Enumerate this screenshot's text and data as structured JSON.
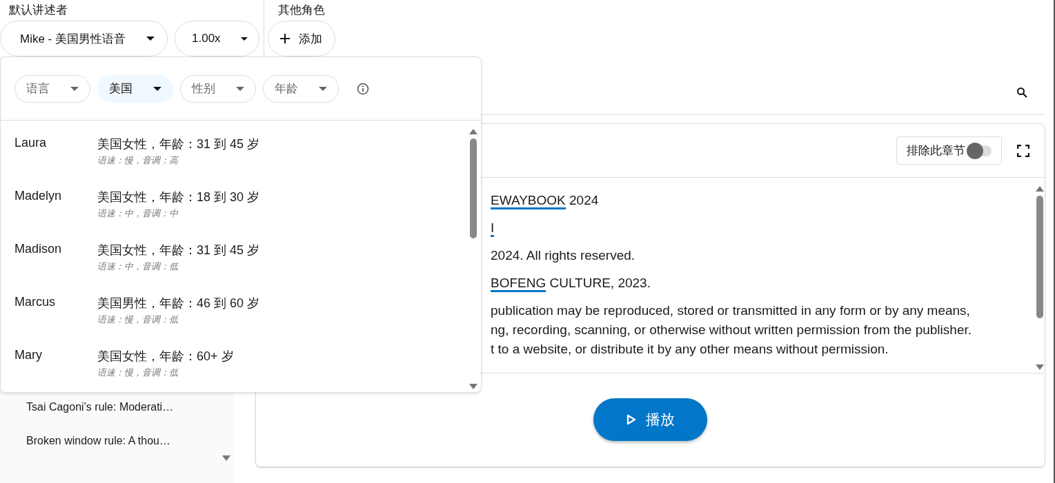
{
  "narrator": {
    "label": "默认讲述者",
    "voice": "Mike - 美国男性语音",
    "speed": "1.00x"
  },
  "other_roles": {
    "label": "其他角色",
    "add_button": "添加"
  },
  "voice_picker": {
    "filters": [
      {
        "label": "语言",
        "selected": false
      },
      {
        "label": "美国",
        "selected": true
      },
      {
        "label": "性别",
        "selected": false
      },
      {
        "label": "年龄",
        "selected": false
      }
    ],
    "voices": [
      {
        "name": "Laura",
        "description": "美国女性，年龄：31 到 45 岁",
        "details": "语速：慢，音调：高"
      },
      {
        "name": "Madelyn",
        "description": "美国女性，年龄：18 到 30 岁",
        "details": "语速：中，音调：中"
      },
      {
        "name": "Madison",
        "description": "美国女性，年龄：31 到 45 岁",
        "details": "语速：中，音调：低"
      },
      {
        "name": "Marcus",
        "description": "美国男性，年龄：46 到 60 岁",
        "details": "语速：慢，音调：低"
      },
      {
        "name": "Mary",
        "description": "美国女性，年龄：60+ 岁",
        "details": "语速：慢，音调：低"
      }
    ]
  },
  "chapters": [
    {
      "title": "Tsai Cagoni’s rule: Moderati…"
    },
    {
      "title": "Broken window rule: A thou…"
    }
  ],
  "chapter": {
    "exclude_label": "排除此章节",
    "exclude": false,
    "paragraphs": [
      [
        {
          "text": "EWAYBOOK",
          "underlined": true
        },
        {
          "text": " 2024",
          "underlined": false
        }
      ],
      [
        {
          "text": "I",
          "underlined": true
        }
      ],
      [
        {
          "text": "2024. All rights reserved.",
          "underlined": false
        }
      ],
      [
        {
          "text": "BOFENG",
          "underlined": true
        },
        {
          "text": " CULTURE, 2023.",
          "underlined": false
        }
      ],
      [
        {
          "text": "publication may be reproduced, stored or transmitted in any form or by any means,",
          "underlined": false
        }
      ],
      [
        {
          "text": "ng, recording, scanning, or otherwise without written permission from the publisher.",
          "underlined": false
        }
      ],
      [
        {
          "text": "t to a website, or distribute it by any other means without permission.",
          "underlined": false
        }
      ]
    ]
  },
  "play_button": "播放"
}
